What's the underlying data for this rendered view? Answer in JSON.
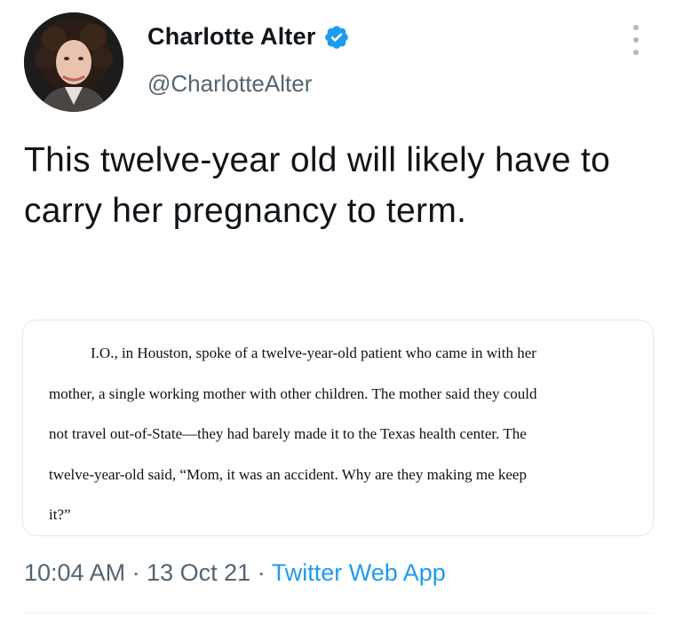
{
  "tweet": {
    "author": {
      "display_name": "Charlotte Alter",
      "handle": "@CharlotteAlter",
      "verified": true,
      "verified_icon": "verified-badge-icon"
    },
    "more_icon": "more-vertical-icon",
    "text": "This twelve-year old will likely have to carry her pregnancy to term.",
    "media": {
      "lines": [
        "I.O., in Houston, spoke of a twelve-year-old patient who came in with her",
        "mother, a single working mother with other children.  The mother said they could",
        "not travel out-of-State—they had barely made it to the Texas health center.  The",
        "twelve-year-old said, “Mom, it was an accident.  Why are they making me keep",
        "it?”"
      ]
    },
    "meta": {
      "time": "10:04 AM",
      "separator": "·",
      "date": "13 Oct 21",
      "source": "Twitter Web App"
    }
  },
  "colors": {
    "text_primary": "#0f1419",
    "text_secondary": "#536471",
    "accent": "#1d9bf0",
    "border": "#e1e8ed"
  }
}
